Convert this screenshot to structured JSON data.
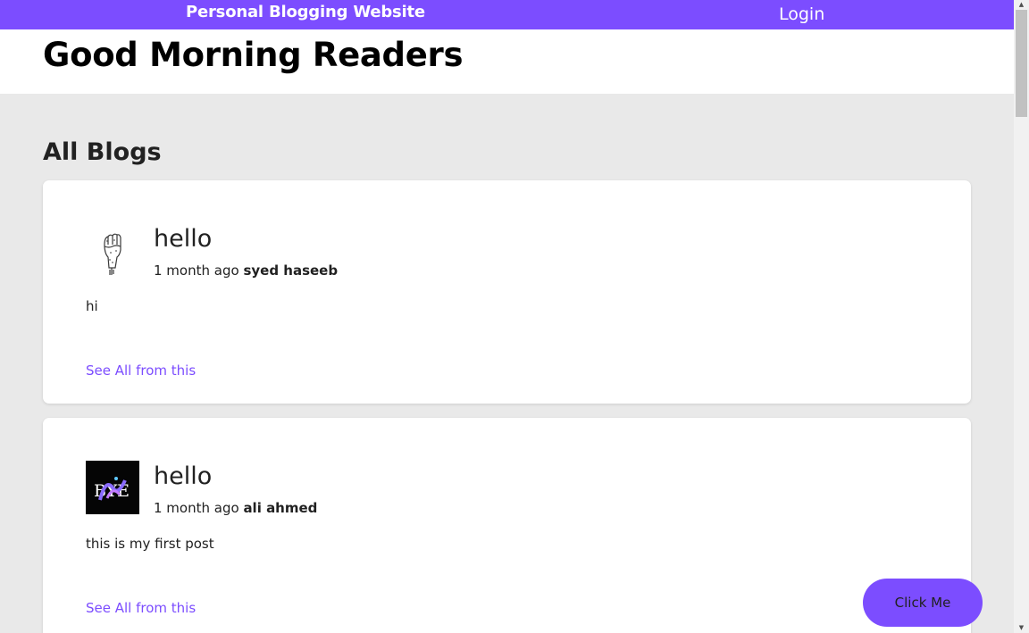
{
  "topbar": {
    "site_title": "Personal Blogging Website",
    "login_label": "Login",
    "accent_color": "#7c4dff"
  },
  "header": {
    "greeting": "Good Morning Readers"
  },
  "main": {
    "section_title": "All Blogs",
    "posts": [
      {
        "title": "hello",
        "time_ago": "1 month ago",
        "author": "syed haseeb",
        "body": "hi",
        "see_all_label": "See All from this",
        "avatar_icon": "raised-fist-icon"
      },
      {
        "title": "hello",
        "time_ago": "1 month ago",
        "author": "ali ahmed",
        "body": "this is my first post",
        "see_all_label": "See All from this",
        "avatar_icon": "logo-bye-icon"
      }
    ]
  },
  "fab": {
    "label": "Click Me"
  }
}
